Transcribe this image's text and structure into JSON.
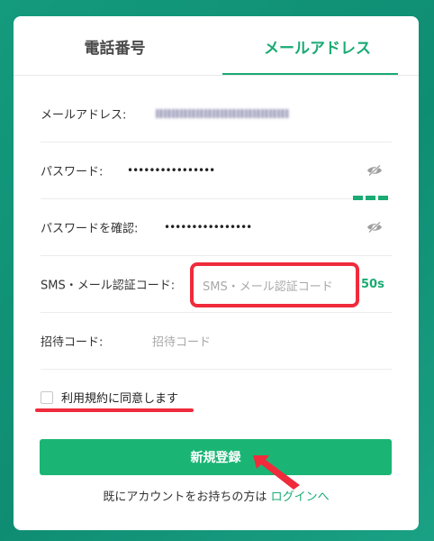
{
  "tabs": {
    "phone_label": "電話番号",
    "email_label": "メールアドレス",
    "active": "email"
  },
  "form": {
    "email": {
      "label": "メールアドレス:"
    },
    "password": {
      "label": "パスワード:",
      "value": "••••••••••••••••"
    },
    "confirm_password": {
      "label": "パスワードを確認:",
      "value": "••••••••••••••••"
    },
    "sms_code": {
      "label": "SMS・メール認証コード:",
      "placeholder": "SMS・メール認証コード",
      "countdown": "50s"
    },
    "invite_code": {
      "label": "招待コード:",
      "placeholder": "招待コード"
    },
    "agree": {
      "label": "利用規約に同意します",
      "checked": false
    }
  },
  "register_button": {
    "label": "新規登録"
  },
  "footer": {
    "text": "既にアカウントをお持ちの方は",
    "link": "ログインへ"
  },
  "icons": {
    "password_visibility": "eye-off-icon"
  },
  "colors": {
    "accent": "#1aab73",
    "button": "#1ab574",
    "annotation": "#ef2b3c",
    "background": "#149a7d"
  }
}
